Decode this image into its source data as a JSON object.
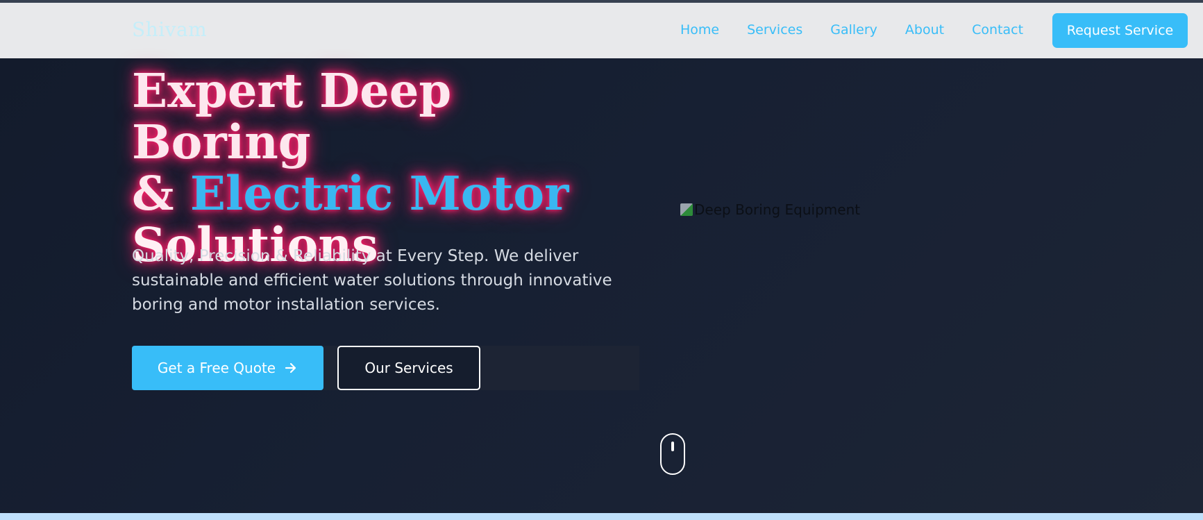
{
  "navbar": {
    "logo": "Shivam",
    "links": [
      "Home",
      "Services",
      "Gallery",
      "About",
      "Contact"
    ],
    "cta_label": "Request Service"
  },
  "hero": {
    "title_line1": "Expert Deep Boring",
    "title_amp": "& ",
    "title_accent": "Electric Motor",
    "title_line3": "Solutions",
    "subtitle": "Quality, Precision & Reliability at Every Step. We deliver sustainable and efficient water solutions through innovative boring and motor installation services.",
    "primary_button": "Get a Free Quote",
    "secondary_button": "Our Services",
    "image_alt": "Deep Boring Equipment"
  },
  "icons": {
    "cta_arrow": "arrow-right-icon",
    "scroll_indicator": "mouse-icon",
    "broken_image": "image-icon"
  },
  "colors": {
    "accent": "#38bdf8",
    "glow": "#ff1f6a",
    "background": "#172033",
    "navbar": "#e8e9eb"
  }
}
